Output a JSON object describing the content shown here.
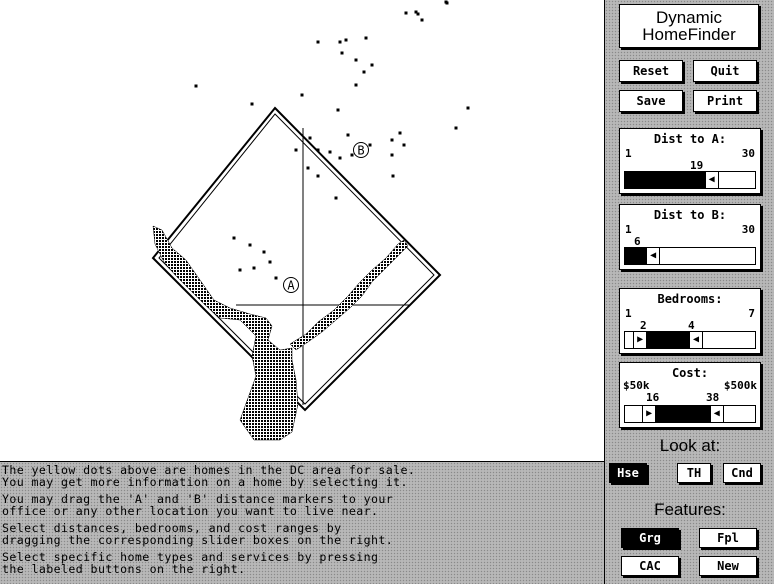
{
  "app": {
    "title_line1": "Dynamic",
    "title_line2": "HomeFinder"
  },
  "toolbar": {
    "reset": "Reset",
    "quit": "Quit",
    "save": "Save",
    "print": "Print"
  },
  "map": {
    "marker_a": "A",
    "marker_b": "B",
    "home_dot_color": "#000000"
  },
  "help": [
    "The yellow dots above are homes in the DC area for sale.",
    "You may get more information on a home by selecting it.",
    "You may drag the 'A' and 'B' distance markers to your",
    "office or any other location you want to live near.",
    "Select distances, bedrooms, and cost ranges by",
    "dragging the corresponding slider boxes on the right.",
    "Select specific home types and services by pressing",
    "the labeled buttons on the right."
  ],
  "sliders": {
    "dist_a": {
      "label": "Dist to A:",
      "min": "1",
      "max": "30",
      "value": "19",
      "fraction": 0.62
    },
    "dist_b": {
      "label": "Dist to B:",
      "min": "1",
      "max": "30",
      "value": "6",
      "fraction": 0.17
    },
    "bedrooms": {
      "label": "Bedrooms:",
      "min": "1",
      "max": "7",
      "low": "2",
      "high": "4",
      "low_fraction": 0.17,
      "high_fraction": 0.5
    },
    "cost": {
      "label": "Cost:",
      "min": "$50k",
      "max": "$500k",
      "low": "16",
      "high": "38",
      "low_fraction": 0.24,
      "high_fraction": 0.66
    }
  },
  "look_at": {
    "label": "Look at:",
    "hse": "Hse",
    "th": "TH",
    "cnd": "Cnd",
    "selected": "Hse"
  },
  "features": {
    "label": "Features:",
    "grg": "Grg",
    "fpl": "Fpl",
    "cac": "CAC",
    "new": "New",
    "selected": "Grg"
  }
}
